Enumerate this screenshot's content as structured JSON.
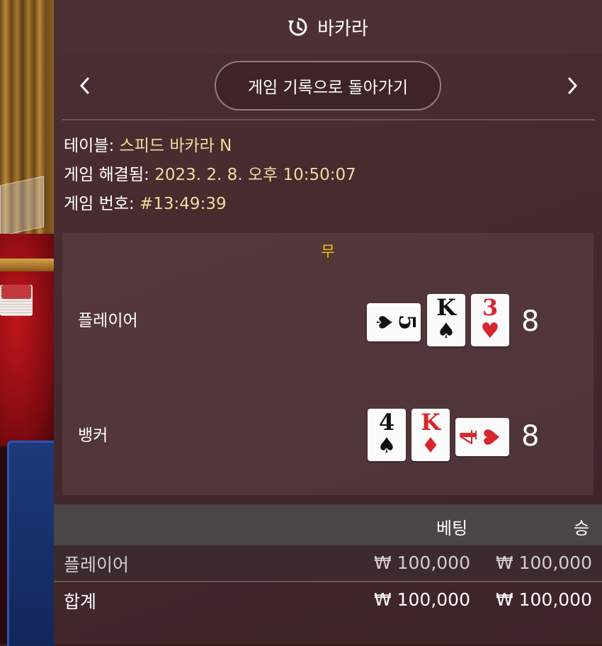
{
  "header": {
    "title": "바카라",
    "icon": "history-icon"
  },
  "nav": {
    "back_label": "게임 기록으로 돌아가기",
    "prev_icon": "chevron-left-icon",
    "next_icon": "chevron-right-icon"
  },
  "info": {
    "table_label": "테이블:",
    "table_value": "스피드 바카라 N",
    "resolved_label": "게임 해결됨:",
    "resolved_value": "2023. 2. 8. 오후 10:50:07",
    "number_label": "게임 번호:",
    "number_value": "#13:49:39"
  },
  "result": {
    "outcome": "무",
    "player": {
      "label": "플레이어",
      "score": "8",
      "cards": [
        {
          "rank": "5",
          "suit": "♠",
          "color": "black",
          "orientation": "horizontal"
        },
        {
          "rank": "K",
          "suit": "♠",
          "color": "black",
          "orientation": "vertical"
        },
        {
          "rank": "3",
          "suit": "♥",
          "color": "red",
          "orientation": "vertical"
        }
      ]
    },
    "banker": {
      "label": "뱅커",
      "score": "8",
      "cards": [
        {
          "rank": "4",
          "suit": "♠",
          "color": "black",
          "orientation": "vertical"
        },
        {
          "rank": "K",
          "suit": "♦",
          "color": "red",
          "orientation": "vertical"
        },
        {
          "rank": "4",
          "suit": "♥",
          "color": "red",
          "orientation": "horizontal"
        }
      ]
    }
  },
  "bets": {
    "col_bet": "베팅",
    "col_win": "승",
    "rows": [
      {
        "label": "플레이어",
        "bet": "₩ 100,000",
        "win": "₩ 100,000"
      },
      {
        "label": "합계",
        "bet": "₩ 100,000",
        "win": "₩ 100,000"
      }
    ]
  },
  "colors": {
    "outcome": "#f6c400",
    "info_value": "#f3d9a0",
    "card_red": "#d8262e"
  }
}
